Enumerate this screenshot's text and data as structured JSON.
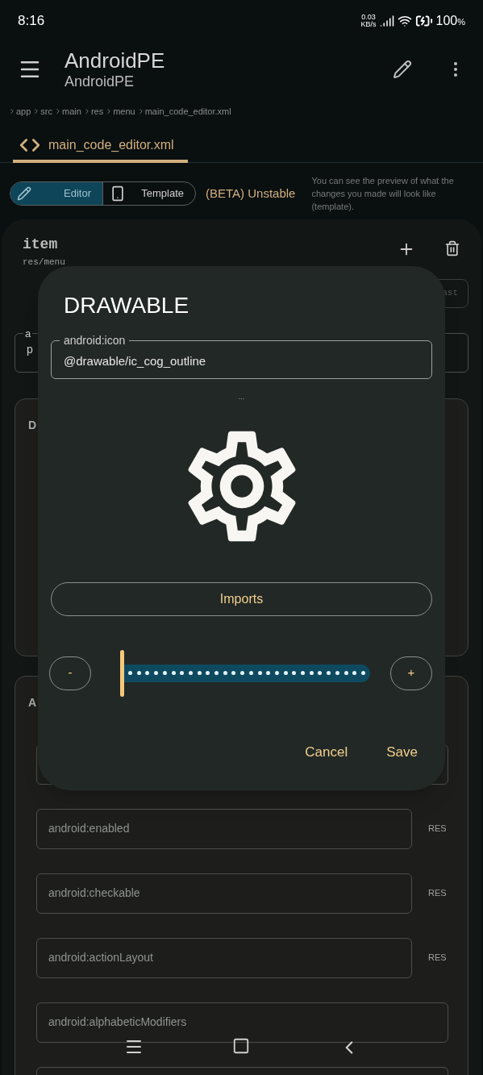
{
  "status_bar": {
    "time": "8:16",
    "net_speed": "0.03",
    "net_unit": "KB/s",
    "battery": "100",
    "battery_unit": "%"
  },
  "app_bar": {
    "title": "AndroidPE",
    "subtitle": "AndroidPE"
  },
  "breadcrumb": [
    "app",
    "src",
    "main",
    "res",
    "menu",
    "main_code_editor.xml"
  ],
  "file_tabs": [
    {
      "label": "main_code_editor.xml",
      "selected": true
    }
  ],
  "mode_toggle": [
    {
      "label": "Editor",
      "selected": true
    },
    {
      "label": "Template",
      "selected": false
    }
  ],
  "beta_label": "(BETA) Unstable",
  "hint": "You can see the preview of what the changes you made will look like (template).",
  "element": {
    "tag": "item",
    "path": "res/menu",
    "button_fragment": "ast",
    "field_label_fragment": "a",
    "field_value_fragment": "p"
  },
  "sections": [
    {
      "title_fragment": "D"
    },
    {
      "title_fragment": "A"
    }
  ],
  "attributes": [
    {
      "placeholder": "android:enabled",
      "badge": "RES"
    },
    {
      "placeholder": "android:checkable",
      "badge": "RES"
    },
    {
      "placeholder": "android:actionLayout",
      "badge": "RES"
    },
    {
      "placeholder": "android:alphabeticModifiers"
    }
  ],
  "dialog": {
    "title": "DRAWABLE",
    "field_label": "android:icon",
    "field_value": "@drawable/ic_cog_outline",
    "ellipsis": "...",
    "imports": "Imports",
    "minus": "-",
    "plus": "+",
    "slider": {
      "level": 0
    },
    "buttons": [
      "Cancel",
      "Save"
    ]
  }
}
